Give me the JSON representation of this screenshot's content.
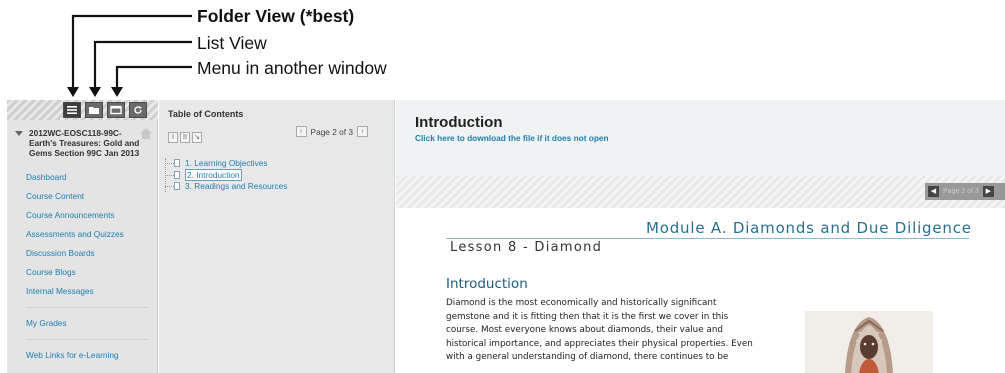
{
  "annotations": {
    "folder_view": "Folder View (*best)",
    "list_view": "List View",
    "menu_window": "Menu in another window"
  },
  "left_nav": {
    "view_buttons": [
      {
        "name": "folder-view",
        "icon": "folder-view-icon"
      },
      {
        "name": "list-view",
        "icon": "list-view-icon"
      },
      {
        "name": "new-window",
        "icon": "new-window-icon"
      },
      {
        "name": "refresh",
        "icon": "refresh-icon"
      }
    ],
    "course_title": "2012WC-EOSC118-99C-Earth's Treasures: Gold and Gems Section 99C Jan 2013",
    "links_top": [
      "Dashboard",
      "Course Content",
      "Course Announcements",
      "Assessments and Quizzes",
      "Discussion Boards",
      "Course Blogs",
      "Internal Messages"
    ],
    "links_mid": [
      "My Grades"
    ],
    "links_bottom": [
      "Web Links for e-Learning"
    ]
  },
  "toc": {
    "title": "Table of Contents",
    "page_text": "Page 2 of 3",
    "items": [
      {
        "label": "1. Learning Objectives",
        "selected": false
      },
      {
        "label": "2. Introduction",
        "selected": true
      },
      {
        "label": "3. Readings and Resources",
        "selected": false
      }
    ]
  },
  "content": {
    "title": "Introduction",
    "download_link": "Click here to download the file if it does not open",
    "pager_text": "Page 2 of 3"
  },
  "document": {
    "module_title": "Module A. Diamonds and Due Diligence",
    "lesson_title": "Lesson 8 - Diamond",
    "section_heading": "Introduction",
    "body_lines": [
      "Diamond is the most economically and historically significant",
      "gemstone and it is fitting then that it is the first we cover in this",
      "course. Most everyone knows about diamonds, their value and",
      "historical importance, and appreciates their physical properties. Even",
      "with a general understanding of diamond, there continues to be"
    ]
  },
  "colors": {
    "link": "#1f7fb0",
    "module_title": "#2a6f8f",
    "nav_bg": "#e4e4e4"
  }
}
